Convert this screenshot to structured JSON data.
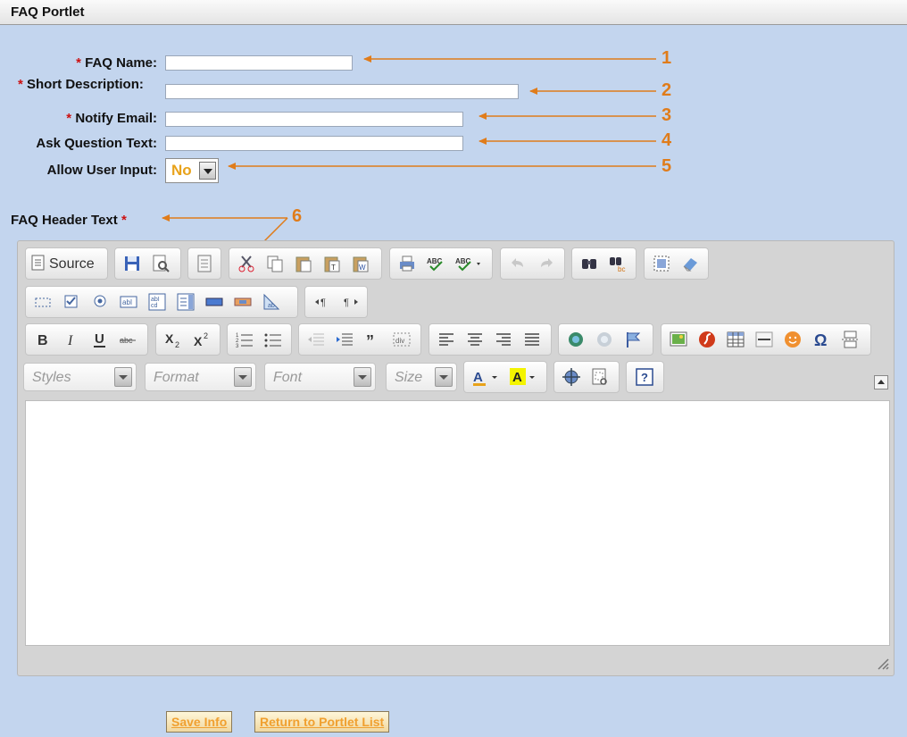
{
  "portlet": {
    "title": "FAQ Portlet"
  },
  "form": {
    "required_mark": "*",
    "faq_name": {
      "label": "FAQ Name:",
      "value": ""
    },
    "short_description": {
      "label": "Short Description:",
      "value": ""
    },
    "notify_email": {
      "label": "Notify Email:",
      "value": ""
    },
    "ask_question_text": {
      "label": "Ask Question Text:",
      "value": ""
    },
    "allow_user_input": {
      "label": "Allow User Input:",
      "value": "No"
    },
    "faq_header_text": {
      "label": "FAQ Header Text"
    }
  },
  "annotations": [
    "1",
    "2",
    "3",
    "4",
    "5",
    "6"
  ],
  "editor": {
    "source_label": "Source",
    "combos": {
      "styles": "Styles",
      "format": "Format",
      "font": "Font",
      "size": "Size"
    },
    "icons_row1": [
      "save-icon",
      "preview-icon",
      "templates-icon",
      "cut-icon",
      "copy-icon",
      "paste-icon",
      "paste-text-icon",
      "paste-word-icon",
      "print-icon",
      "spell-check-icon",
      "spell-check-as-you-type-icon",
      "undo-icon",
      "redo-icon",
      "find-icon",
      "replace-icon",
      "select-all-icon",
      "remove-format-icon"
    ],
    "icons_row2": [
      "form-icon",
      "checkbox-icon",
      "radio-icon",
      "text-field-icon",
      "textarea-icon",
      "select-field-icon",
      "button-icon",
      "image-button-icon",
      "hidden-field-icon",
      "bidi-ltr-icon",
      "bidi-rtl-icon"
    ],
    "icons_row3": [
      "bold-icon",
      "italic-icon",
      "underline-icon",
      "strike-icon",
      "subscript-icon",
      "superscript-icon",
      "numbered-list-icon",
      "bulleted-list-icon",
      "outdent-icon",
      "indent-icon",
      "blockquote-icon",
      "create-div-icon",
      "align-left-icon",
      "align-center-icon",
      "align-right-icon",
      "justify-icon",
      "link-icon",
      "unlink-icon",
      "anchor-icon",
      "image-icon",
      "flash-icon",
      "table-icon",
      "horizontal-rule-icon",
      "smiley-icon",
      "special-char-icon",
      "page-break-icon"
    ],
    "icons_row4": [
      "text-color-icon",
      "background-color-icon",
      "maximize-icon",
      "show-blocks-icon",
      "about-icon"
    ]
  },
  "buttons": {
    "save": "Save Info",
    "return": "Return to Portlet List"
  },
  "colors": {
    "accent": "#e07c1a",
    "background": "#c3d5ee",
    "required": "#cc1111"
  }
}
